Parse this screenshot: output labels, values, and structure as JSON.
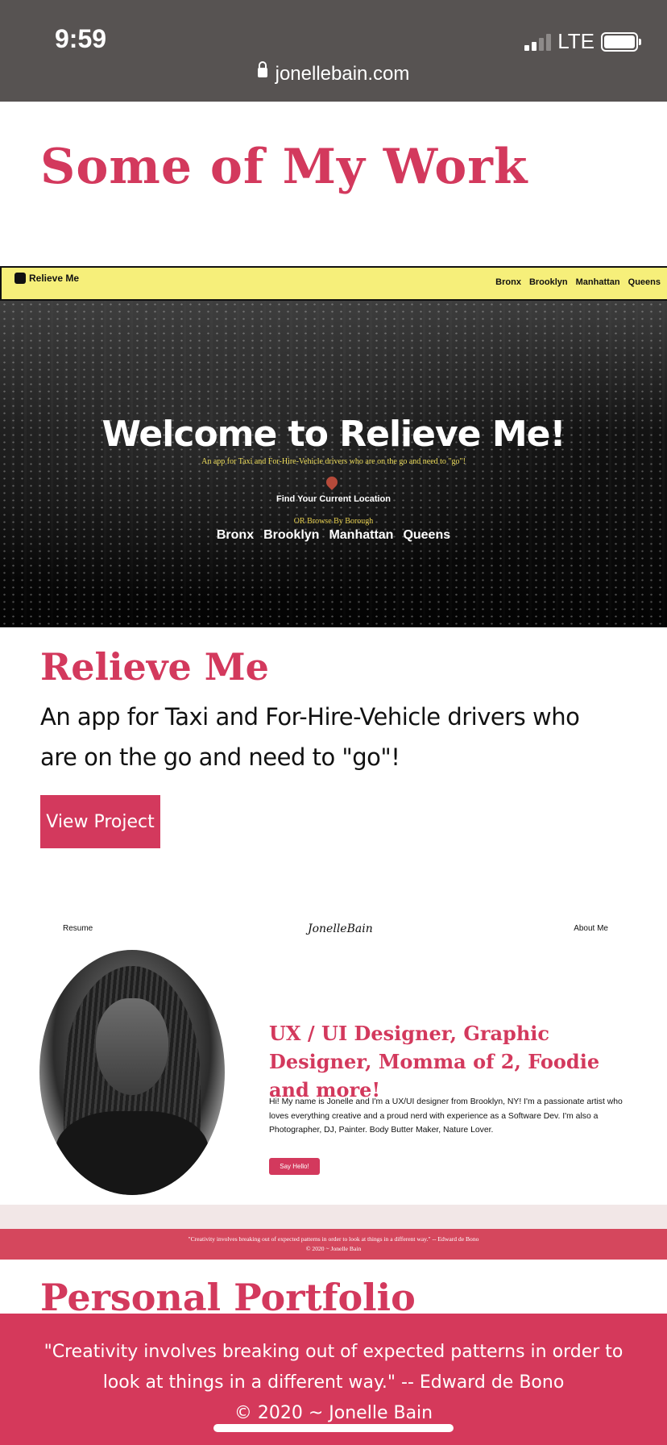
{
  "status_bar": {
    "time": "9:59",
    "network": "LTE",
    "url": "jonellebain.com"
  },
  "section1_heading": "Some of My Work",
  "relieve_me_screenshot": {
    "logo": "Relieve Me",
    "nav_links": [
      "Bronx",
      "Brooklyn",
      "Manhattan",
      "Queens"
    ],
    "hero_title": "Welcome to Relieve Me!",
    "hero_subtitle": "An app for Taxi and For-Hire-Vehicle drivers who are on the go and need to \"go\"!",
    "find_location": "Find Your Current Location",
    "browse_label": "OR Browse By Borough",
    "boroughs": [
      "Bronx",
      "Brooklyn",
      "Manhattan",
      "Queens"
    ]
  },
  "project": {
    "title": "Relieve Me",
    "description": "An app for Taxi and For-Hire-Vehicle drivers who are on the go and need to \"go\"!",
    "button_label": "View Project"
  },
  "portfolio_screenshot": {
    "nav_left": "Resume",
    "nav_center": "JonelleBain",
    "nav_right": "About Me",
    "heading": "UX / UI Designer, Graphic Designer, Momma of 2, Foodie and more!",
    "body": "Hi! My name is Jonelle and I'm a UX/UI designer from Brooklyn, NY! I'm a passionate artist who loves everything creative and a proud nerd with experience as a Software Dev. I'm also a Photographer, DJ, Painter. Body Butter Maker, Nature Lover.",
    "button": "Say Hello!",
    "footer_quote": "\"Creativity involves breaking out of expected patterns in order to look at things in a different way.\" -- Edward de Bono",
    "footer_copyright": "© 2020 ~ Jonelle Bain"
  },
  "section2_heading": "Personal Portfolio",
  "footer": {
    "quote": "\"Creativity involves breaking out of expected patterns in order to look at things in a different way.\" -- Edward de Bono",
    "copyright": "© 2020 ~ Jonelle Bain"
  },
  "colors": {
    "accent": "#d3395d",
    "status_bar": "#575352",
    "relieve_nav": "#f6ef7a"
  }
}
